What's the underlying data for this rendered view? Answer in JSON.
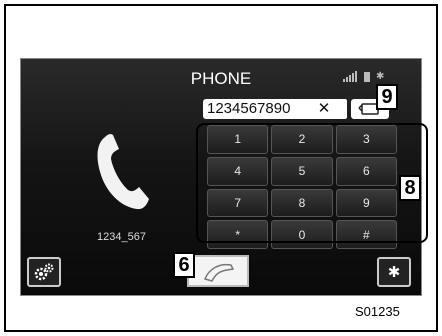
{
  "screen": {
    "title": "PHONE",
    "dialed_number": "1234567890",
    "backspace_glyph": "✕",
    "contact_number": "1234_567",
    "bluetooth_glyph": "✱",
    "status_bluetooth_glyph": "✱",
    "keys": [
      "1",
      "2",
      "3",
      "4",
      "5",
      "6",
      "7",
      "8",
      "9",
      "*",
      "0",
      "#"
    ],
    "icons": {
      "handset": "phone-handset-icon",
      "settings": "gears-icon",
      "call": "call-icon",
      "bluetooth": "bluetooth-icon",
      "flip": "keypad-toggle-icon",
      "signal": "signal-strength-icon",
      "battery": "battery-icon"
    }
  },
  "callouts": {
    "call_button": "6",
    "keypad": "8",
    "toggle_button": "9"
  },
  "figure_code": "S01235",
  "colors": {
    "screen_background": "#141414",
    "key_text": "#e8e8e8",
    "callout_border": "#000000"
  }
}
